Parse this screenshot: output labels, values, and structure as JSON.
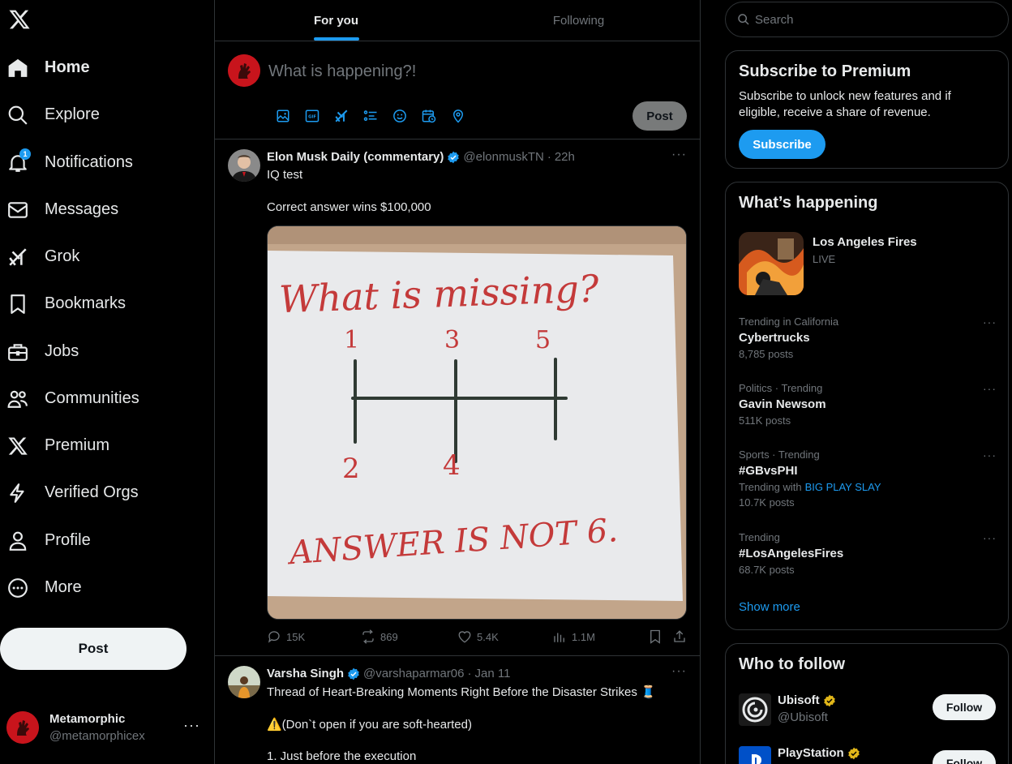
{
  "app": {
    "name": "X"
  },
  "nav": {
    "items": [
      {
        "label": "Home",
        "icon": "home-icon"
      },
      {
        "label": "Explore",
        "icon": "search-icon"
      },
      {
        "label": "Notifications",
        "icon": "bell-icon",
        "badge": "1"
      },
      {
        "label": "Messages",
        "icon": "envelope-icon"
      },
      {
        "label": "Grok",
        "icon": "grok-icon"
      },
      {
        "label": "Bookmarks",
        "icon": "bookmark-icon"
      },
      {
        "label": "Jobs",
        "icon": "briefcase-icon"
      },
      {
        "label": "Communities",
        "icon": "people-icon"
      },
      {
        "label": "Premium",
        "icon": "x-logo-icon"
      },
      {
        "label": "Verified Orgs",
        "icon": "lightning-icon"
      },
      {
        "label": "Profile",
        "icon": "person-icon"
      },
      {
        "label": "More",
        "icon": "more-circle-icon"
      }
    ],
    "post_label": "Post"
  },
  "account": {
    "name": "Metamorphic",
    "handle": "@metamorphicex",
    "more": "···"
  },
  "tabs": {
    "for_you": "For you",
    "following": "Following"
  },
  "composer": {
    "placeholder": "What is happening?!",
    "post_label": "Post"
  },
  "tweets": [
    {
      "author": "Elon Musk Daily (commentary)",
      "handle": "@elonmuskTN",
      "time": "22h",
      "lines": [
        "IQ test",
        "Correct answer wins $100,000"
      ],
      "image": {
        "title": "What is missing?",
        "digits_top": [
          "1",
          "3",
          "5"
        ],
        "digits_bottom": [
          "2",
          "4"
        ],
        "bottom_text": "ANSWER IS NOT 6."
      },
      "stats": {
        "replies": "15K",
        "reposts": "869",
        "likes": "5.4K",
        "views": "1.1M"
      }
    },
    {
      "author": "Varsha Singh",
      "handle": "@varshaparmar06",
      "time": "Jan 11",
      "lines": [
        "Thread of Heart-Breaking Moments Right Before the Disaster Strikes 🧵",
        "⚠️(Don`t open if you are soft-hearted)",
        "1. Just before the execution"
      ]
    }
  ],
  "search": {
    "placeholder": "Search"
  },
  "premium": {
    "title": "Subscribe to Premium",
    "text": "Subscribe to unlock new features and if eligible, receive a share of revenue.",
    "button": "Subscribe"
  },
  "happening": {
    "title": "What’s happening",
    "featured": {
      "title": "Los Angeles Fires",
      "status": "LIVE"
    },
    "trends": [
      {
        "context": "Trending in California",
        "title": "Cybertrucks",
        "count": "8,785 posts"
      },
      {
        "context": "Politics · Trending",
        "title": "Gavin Newsom",
        "count": "511K posts"
      },
      {
        "context": "Sports · Trending",
        "title": "#GBvsPHI",
        "with_label": "Trending with",
        "with_link": "BIG PLAY SLAY",
        "count": "10.7K posts"
      },
      {
        "context": "Trending",
        "title": "#LosAngelesFires",
        "count": "68.7K posts"
      }
    ],
    "show_more": "Show more"
  },
  "who_to_follow": {
    "title": "Who to follow",
    "accounts": [
      {
        "name": "Ubisoft",
        "handle": "@Ubisoft",
        "button": "Follow"
      },
      {
        "name": "PlayStation",
        "handle": "",
        "button": "Follow"
      }
    ]
  },
  "colors": {
    "accent": "#1d9bf0",
    "background": "#000000",
    "border": "#2f3336",
    "muted": "#71767b",
    "gold_badge": "#e2b719",
    "red": "#c8141c"
  }
}
